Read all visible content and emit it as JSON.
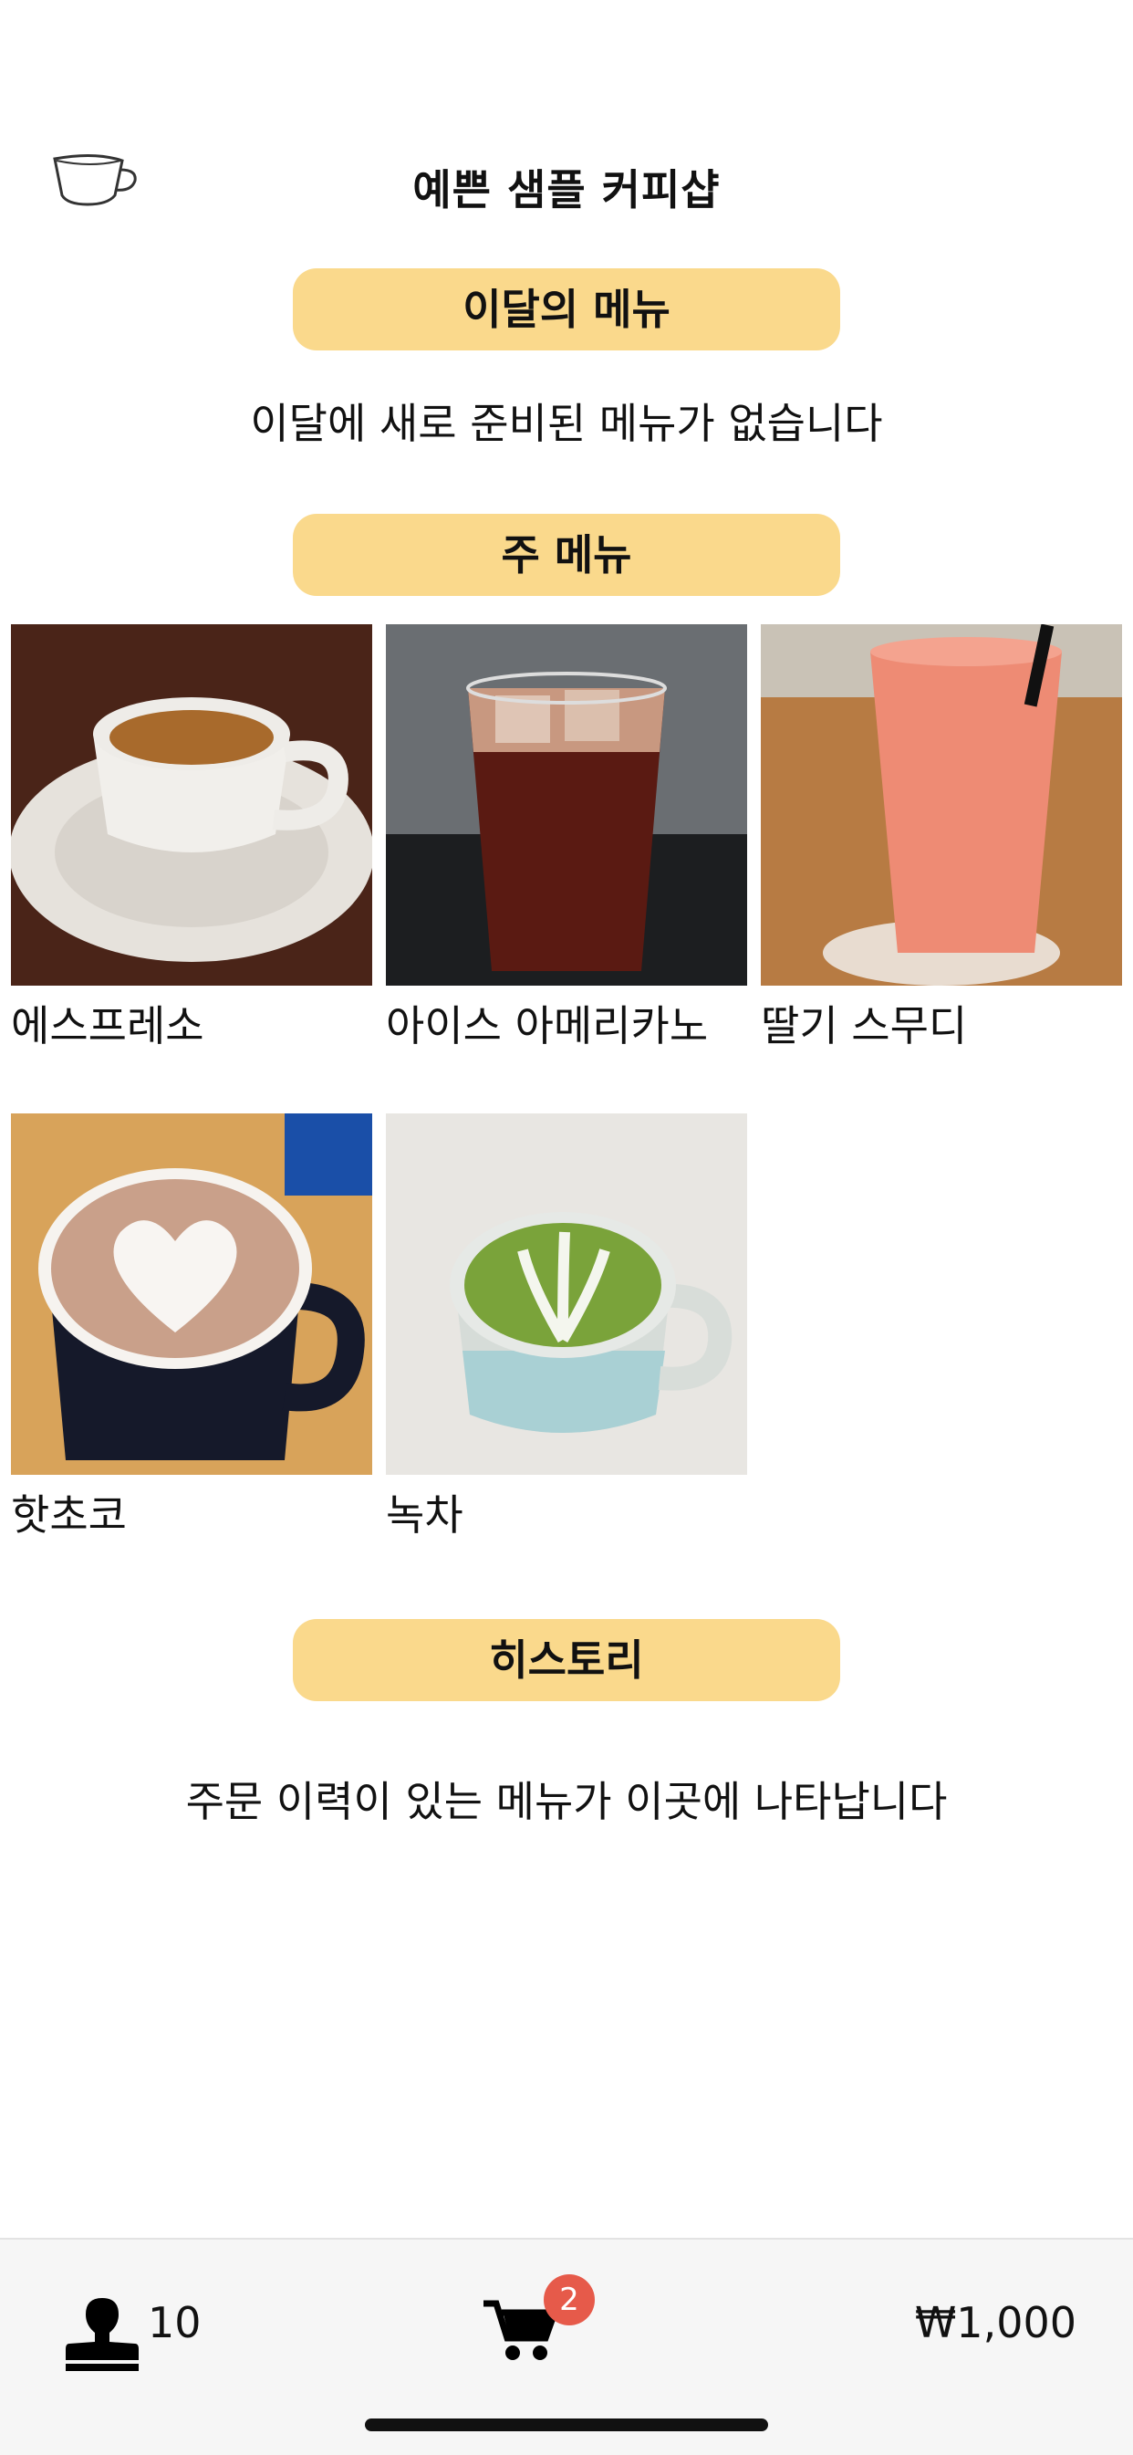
{
  "header": {
    "title": "예쁜 샘플 커피샵",
    "icon": "coffee-cup-icon"
  },
  "sections": {
    "monthly": {
      "title": "이달의 메뉴",
      "empty_message": "이달에 새로 준비된 메뉴가 없습니다"
    },
    "main": {
      "title": "주 메뉴",
      "items": [
        {
          "name": "에스프레소"
        },
        {
          "name": "아이스 아메리카노"
        },
        {
          "name": "딸기 스무디"
        },
        {
          "name": "핫초코"
        },
        {
          "name": "녹차"
        }
      ]
    },
    "history": {
      "title": "히스토리",
      "empty_message": "주문 이력이 있는 메뉴가 이곳에 나타납니다"
    }
  },
  "tabbar": {
    "stamp_icon": "stamp-icon",
    "stamp_count": "10",
    "cart_icon": "cart-icon",
    "cart_badge": "2",
    "price": "₩1,000"
  },
  "colors": {
    "pill": "#fad98c",
    "badge": "#e65a4a",
    "tabbar": "#f6f6f6"
  }
}
